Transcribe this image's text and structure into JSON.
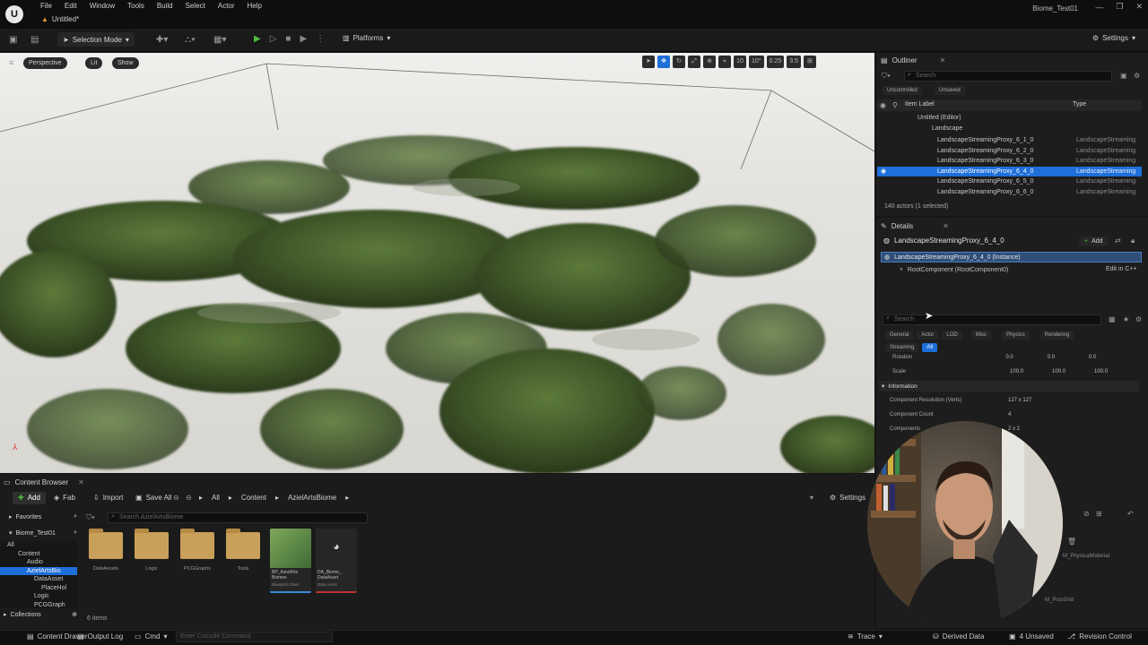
{
  "titlebar": {
    "menu": [
      "File",
      "Edit",
      "Window",
      "Tools",
      "Build",
      "Select",
      "Actor",
      "Help"
    ],
    "doc_tab": "Untitled*",
    "project": "Biome_Test01"
  },
  "toolbar": {
    "selection_mode": "Selection Mode",
    "platforms": "Platforms",
    "settings": "Settings"
  },
  "viewport": {
    "perspective": "Perspective",
    "lit": "Lit",
    "show": "Show",
    "snap_angle": "10°",
    "snap_scale": "0.25",
    "camera_speed": "3.5",
    "grid": "10"
  },
  "outliner": {
    "title": "Outliner",
    "search_placeholder": "Search",
    "filter_uncontrolled": "Uncontrolled",
    "filter_unsaved": "Unsaved",
    "col_label": "Item Label",
    "col_type": "Type",
    "rows": [
      {
        "label": "Untitled (Editor)",
        "type": ""
      },
      {
        "label": "Landscape",
        "type": ""
      },
      {
        "label": "LandscapeStreamingProxy_6_1_0",
        "type": "LandscapeStreaming"
      },
      {
        "label": "LandscapeStreamingProxy_6_2_0",
        "type": "LandscapeStreaming"
      },
      {
        "label": "LandscapeStreamingProxy_6_3_0",
        "type": "LandscapeStreaming"
      },
      {
        "label": "LandscapeStreamingProxy_6_4_0",
        "type": "LandscapeStreaming"
      },
      {
        "label": "LandscapeStreamingProxy_6_5_0",
        "type": "LandscapeStreaming"
      },
      {
        "label": "LandscapeStreamingProxy_6_6_0",
        "type": "LandscapeStreaming"
      }
    ],
    "count": "140 actors (1 selected)"
  },
  "details": {
    "title": "Details",
    "actor": "LandscapeStreamingProxy_6_4_0",
    "add": "Add",
    "instance": "LandscapeStreamingProxy_6_4_0 (Instance)",
    "root": "RootComponent (RootComponent0)",
    "edit_cpp": "Edit in C++",
    "search_placeholder": "Search",
    "tabs": [
      "General",
      "Actor",
      "LOD",
      "Misc",
      "Physics",
      "Rendering"
    ],
    "tabs2": [
      "Streaming",
      "All"
    ],
    "rotation_label": "Rotation",
    "rotation_vals": [
      "0.0",
      "0.0",
      "0.0"
    ],
    "scale_label": "Scale",
    "scale_vals": [
      "100.0",
      "100.0",
      "100.0"
    ],
    "section": "Information",
    "props": [
      {
        "label": "Component Resolution (Verts)",
        "value": "127 x 127"
      },
      {
        "label": "Component Count",
        "value": "4"
      },
      {
        "label": "Components",
        "value": "2 x 2"
      }
    ],
    "material_hint": "M_PhysicalMaterial",
    "proc_hint": "M_ProcGrid"
  },
  "content_browser": {
    "title": "Content Browser",
    "add": "Add",
    "fab": "Fab",
    "import": "Import",
    "save_all": "Save All",
    "path": [
      "All",
      "Content",
      "AzielArtsBiome"
    ],
    "settings": "Settings",
    "search_placeholder": "Search AzielArtsBiome",
    "favorites": "Favorites",
    "project": "Biome_Test01",
    "tree": [
      "All",
      "Content",
      "Audio",
      "AzielArtsBio",
      "DataAsset",
      "PlaceHol",
      "Logic",
      "PCGGraph"
    ],
    "collections": "Collections",
    "assets": [
      {
        "name": "DataAssets",
        "kind": "folder"
      },
      {
        "name": "Logic",
        "kind": "folder"
      },
      {
        "name": "PCGGraphs",
        "kind": "folder"
      },
      {
        "name": "Tools",
        "kind": "folder"
      },
      {
        "name": "BP_AzielArts Biomes",
        "sub": "Blueprint Class",
        "kind": "bp"
      },
      {
        "name": "DA_Biome_ DataAsset",
        "sub": "Data Asset",
        "kind": "da"
      }
    ],
    "items": "6 items"
  },
  "statusbar": {
    "content_drawer": "Content Drawer",
    "output_log": "Output Log",
    "cmd": "Cmd",
    "console_placeholder": "Enter Console Command",
    "trace": "Trace",
    "derived_data": "Derived Data",
    "unsaved": "4 Unsaved",
    "revision": "Revision Control"
  }
}
